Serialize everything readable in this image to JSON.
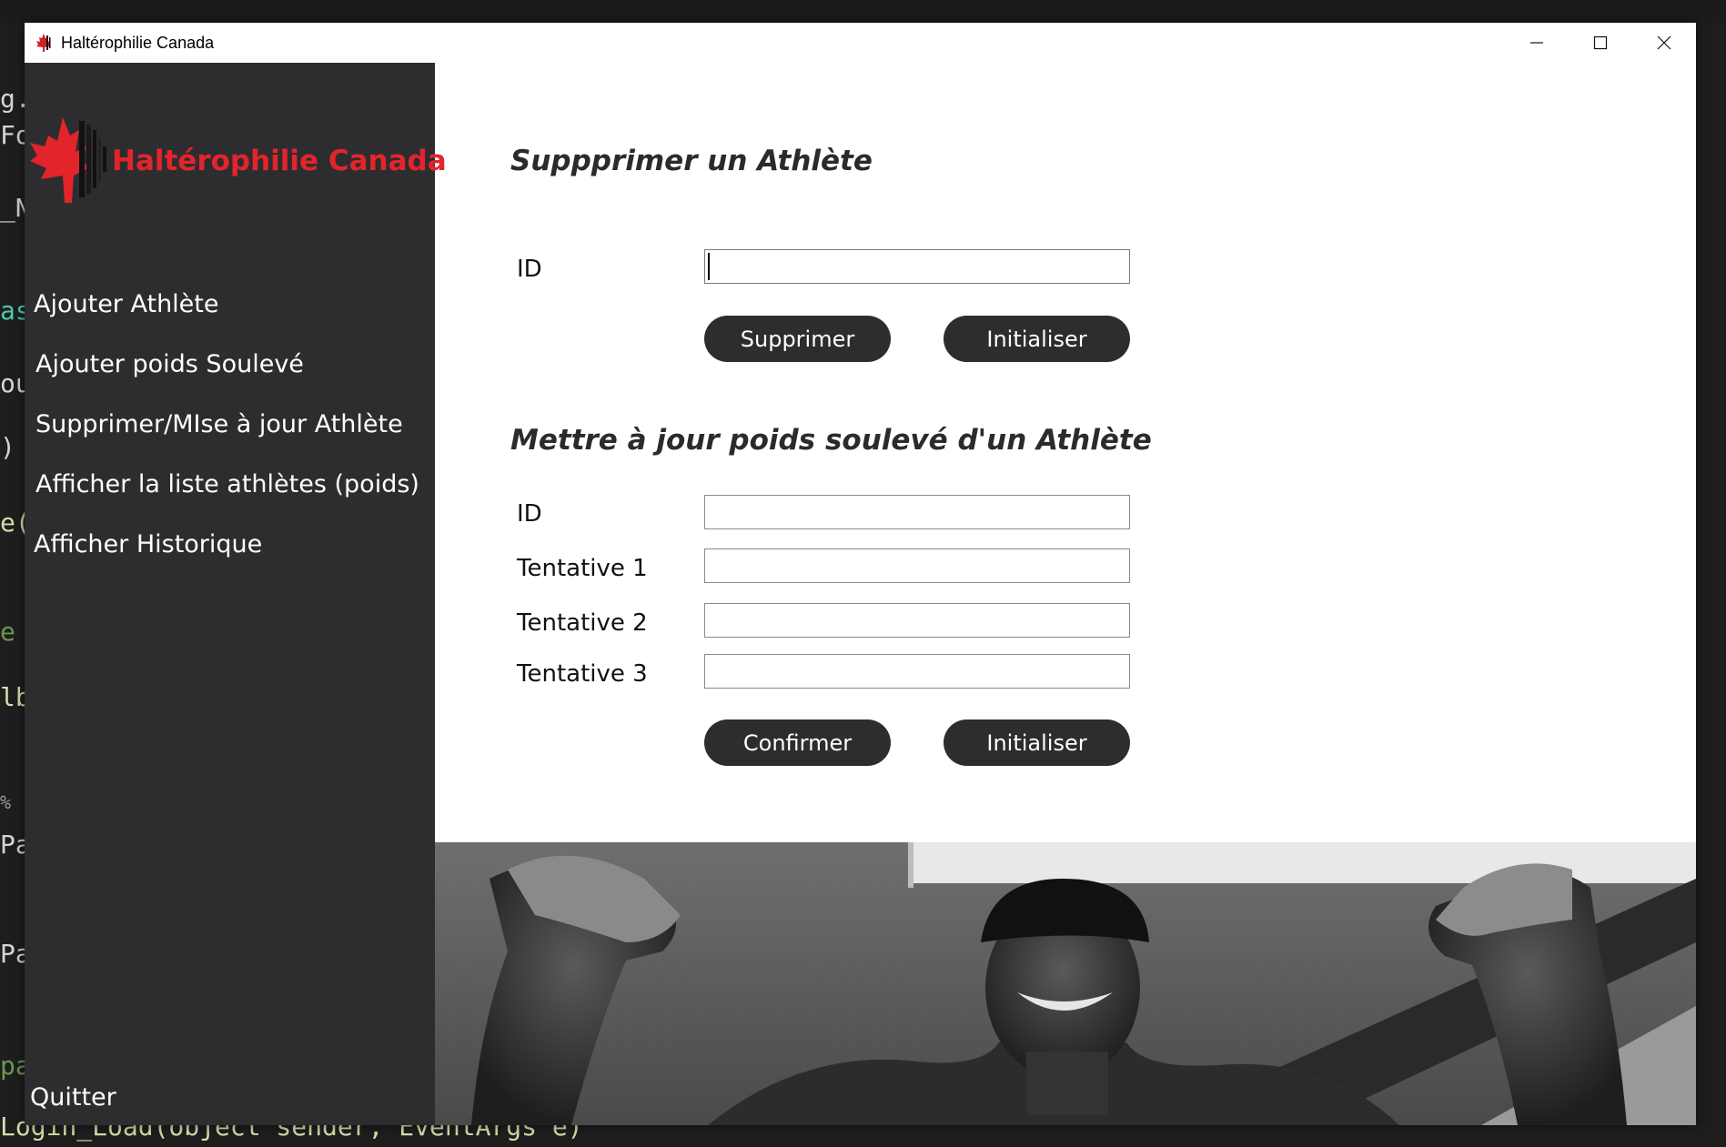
{
  "window": {
    "title": "Haltérophilie Canada",
    "controls": {
      "minimize": "—",
      "maximize": "☐",
      "close": "✕"
    },
    "icon": "maple-leaf-icon"
  },
  "sidebar": {
    "brand": "Haltérophilie Canada",
    "logo": "maple-leaf-barbell-logo",
    "items": [
      {
        "label": "Ajouter Athlète"
      },
      {
        "label": "Ajouter poids Soulevé"
      },
      {
        "label": "Supprimer/MIse à jour Athlète"
      },
      {
        "label": "Afficher la liste athlètes (poids)"
      },
      {
        "label": "Afficher Historique"
      }
    ],
    "quit": "Quitter"
  },
  "delete_section": {
    "title": "Suppprimer un Athlète",
    "id_label": "ID",
    "id_value": "",
    "delete_button": "Supprimer",
    "reset_button": "Initialiser"
  },
  "update_section": {
    "title": "Mettre à jour poids soulevé d'un Athlète",
    "id_label": "ID",
    "attempt1_label": "Tentative 1",
    "attempt2_label": "Tentative 2",
    "attempt3_label": "Tentative 3",
    "confirm_button": "Confirmer",
    "reset_button": "Initialiser"
  },
  "photo": {
    "subject": "weightlifter-flexing-photo"
  },
  "background_code": {
    "lines": [
      "g.",
      "Fo",
      "_N",
      "as",
      "ou",
      ")",
      "e(",
      "e",
      "lb",
      "%",
      "Pa",
      "Pa",
      "pa",
      "Login_Load(object sender, EventArgs e)"
    ]
  },
  "colors": {
    "sidebar_bg": "#2d2d30",
    "brand_red": "#e3242b",
    "button_bg": "#2d2d30",
    "window_bg": "#ffffff"
  }
}
